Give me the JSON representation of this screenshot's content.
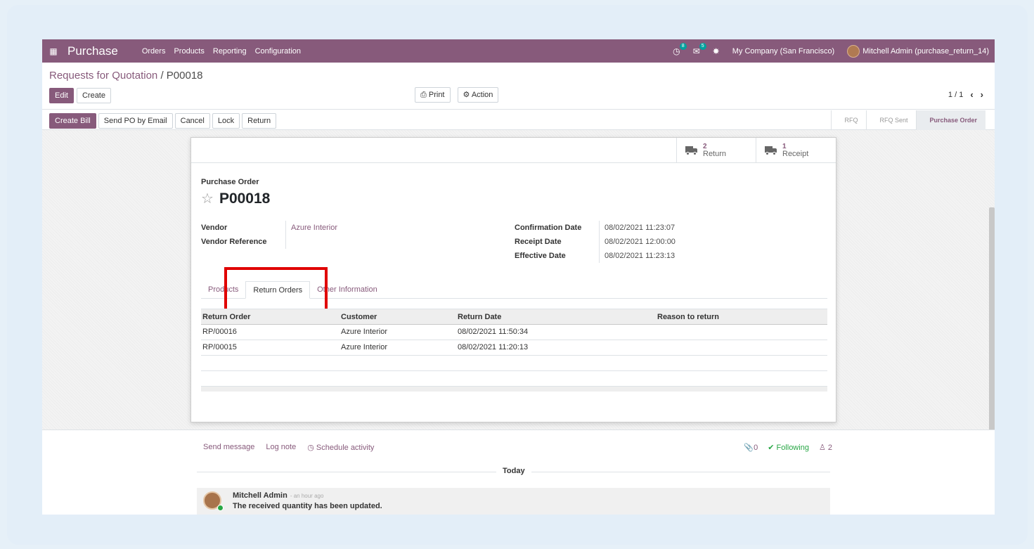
{
  "navbar": {
    "app_name": "Purchase",
    "menu": [
      "Orders",
      "Products",
      "Reporting",
      "Configuration"
    ],
    "activity_count": "8",
    "message_count": "5",
    "company": "My Company (San Francisco)",
    "user": "Mitchell Admin (purchase_return_14)"
  },
  "breadcrumb": {
    "parent": "Requests for Quotation",
    "separator": "/",
    "current": "P00018"
  },
  "control": {
    "edit": "Edit",
    "create": "Create",
    "print": "Print",
    "action": "Action",
    "pager": "1 / 1"
  },
  "statusbar": {
    "buttons": [
      "Create Bill",
      "Send PO by Email",
      "Cancel",
      "Lock",
      "Return"
    ],
    "stages": [
      "RFQ",
      "RFQ Sent",
      "Purchase Order"
    ],
    "active_stage": "Purchase Order"
  },
  "smart_buttons": [
    {
      "count": "2",
      "label": "Return"
    },
    {
      "count": "1",
      "label": "Receipt"
    }
  ],
  "document": {
    "type_label": "Purchase Order",
    "name": "P00018"
  },
  "fields_left": [
    {
      "label": "Vendor",
      "value": "Azure Interior"
    },
    {
      "label": "Vendor Reference",
      "value": ""
    }
  ],
  "fields_right": [
    {
      "label": "Confirmation Date",
      "value": "08/02/2021 11:23:07"
    },
    {
      "label": "Receipt Date",
      "value": "08/02/2021 12:00:00"
    },
    {
      "label": "Effective Date",
      "value": "08/02/2021 11:23:13"
    }
  ],
  "tabs": [
    "Products",
    "Return Orders",
    "Other Information"
  ],
  "return_table": {
    "headers": [
      "Return Order",
      "Customer",
      "Return Date",
      "Reason to return"
    ],
    "rows": [
      [
        "RP/00016",
        "Azure Interior",
        "08/02/2021 11:50:34",
        ""
      ],
      [
        "RP/00015",
        "Azure Interior",
        "08/02/2021 11:20:13",
        ""
      ]
    ]
  },
  "chatter": {
    "send_message": "Send message",
    "log_note": "Log note",
    "schedule_activity": "Schedule activity",
    "attachments": "0",
    "following": "Following",
    "followers": "2",
    "date_separator": "Today",
    "message": {
      "author": "Mitchell Admin",
      "time": "- an hour ago",
      "body": "The received quantity has been updated."
    }
  },
  "colors": {
    "brand": "#875a7b",
    "highlight": "#e00000",
    "success": "#28a745",
    "badge": "#00a09d"
  }
}
